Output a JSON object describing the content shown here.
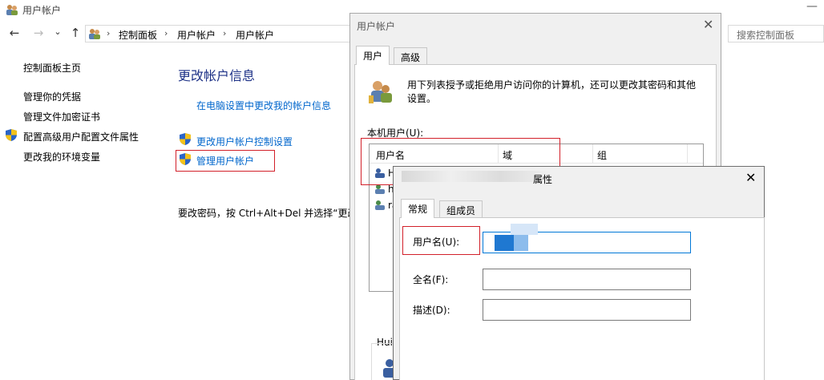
{
  "window": {
    "title": "用户帐户",
    "minimize": "—"
  },
  "nav": {
    "back": "←",
    "forward": "→",
    "dropdown": "⌄",
    "up": "↑"
  },
  "breadcrumb": {
    "items": [
      "控制面板",
      "用户帐户",
      "用户帐户"
    ],
    "separator": "›"
  },
  "search": {
    "placeholder": "搜索控制面板"
  },
  "sidebar": {
    "items": [
      "控制面板主页",
      "管理你的凭据",
      "管理文件加密证书",
      "配置高级用户配置文件属性",
      "更改我的环境变量"
    ]
  },
  "main": {
    "heading": "更改帐户信息",
    "pc_settings_link": "在电脑设置中更改我的帐户信息",
    "uac_link": "更改用户帐户控制设置",
    "manage_link": "管理用户帐户",
    "password_text": "要改密码，按 Ctrl+Alt+Del 并选择“更改"
  },
  "ua_dialog": {
    "title": "用户帐户",
    "close": "✕",
    "tabs": [
      "用户",
      "高级"
    ],
    "description": "用下列表授予或拒绝用户访问你的计算机，还可以更改其密码和其他设置。",
    "local_users_label": "本机用户(U):",
    "columns": [
      "用户名",
      "域",
      "组"
    ],
    "rows": [
      "H",
      "h",
      "ra"
    ],
    "group_label": "Huin"
  },
  "prop_dialog": {
    "title_suffix": "属性",
    "close": "✕",
    "tabs": [
      "常规",
      "组成员"
    ],
    "fields": [
      {
        "label": "用户名(U):",
        "value": ""
      },
      {
        "label": "全名(F):",
        "value": ""
      },
      {
        "label": "描述(D):",
        "value": ""
      }
    ]
  },
  "colors": {
    "link": "#0066cc",
    "heading": "#1e3287",
    "highlight_box": "#d2202a",
    "field_focus_border": "#0078d7"
  },
  "icons": [
    "users-icon",
    "shield-icon",
    "close-icon",
    "back-arrow-icon",
    "forward-arrow-icon",
    "up-arrow-icon"
  ]
}
